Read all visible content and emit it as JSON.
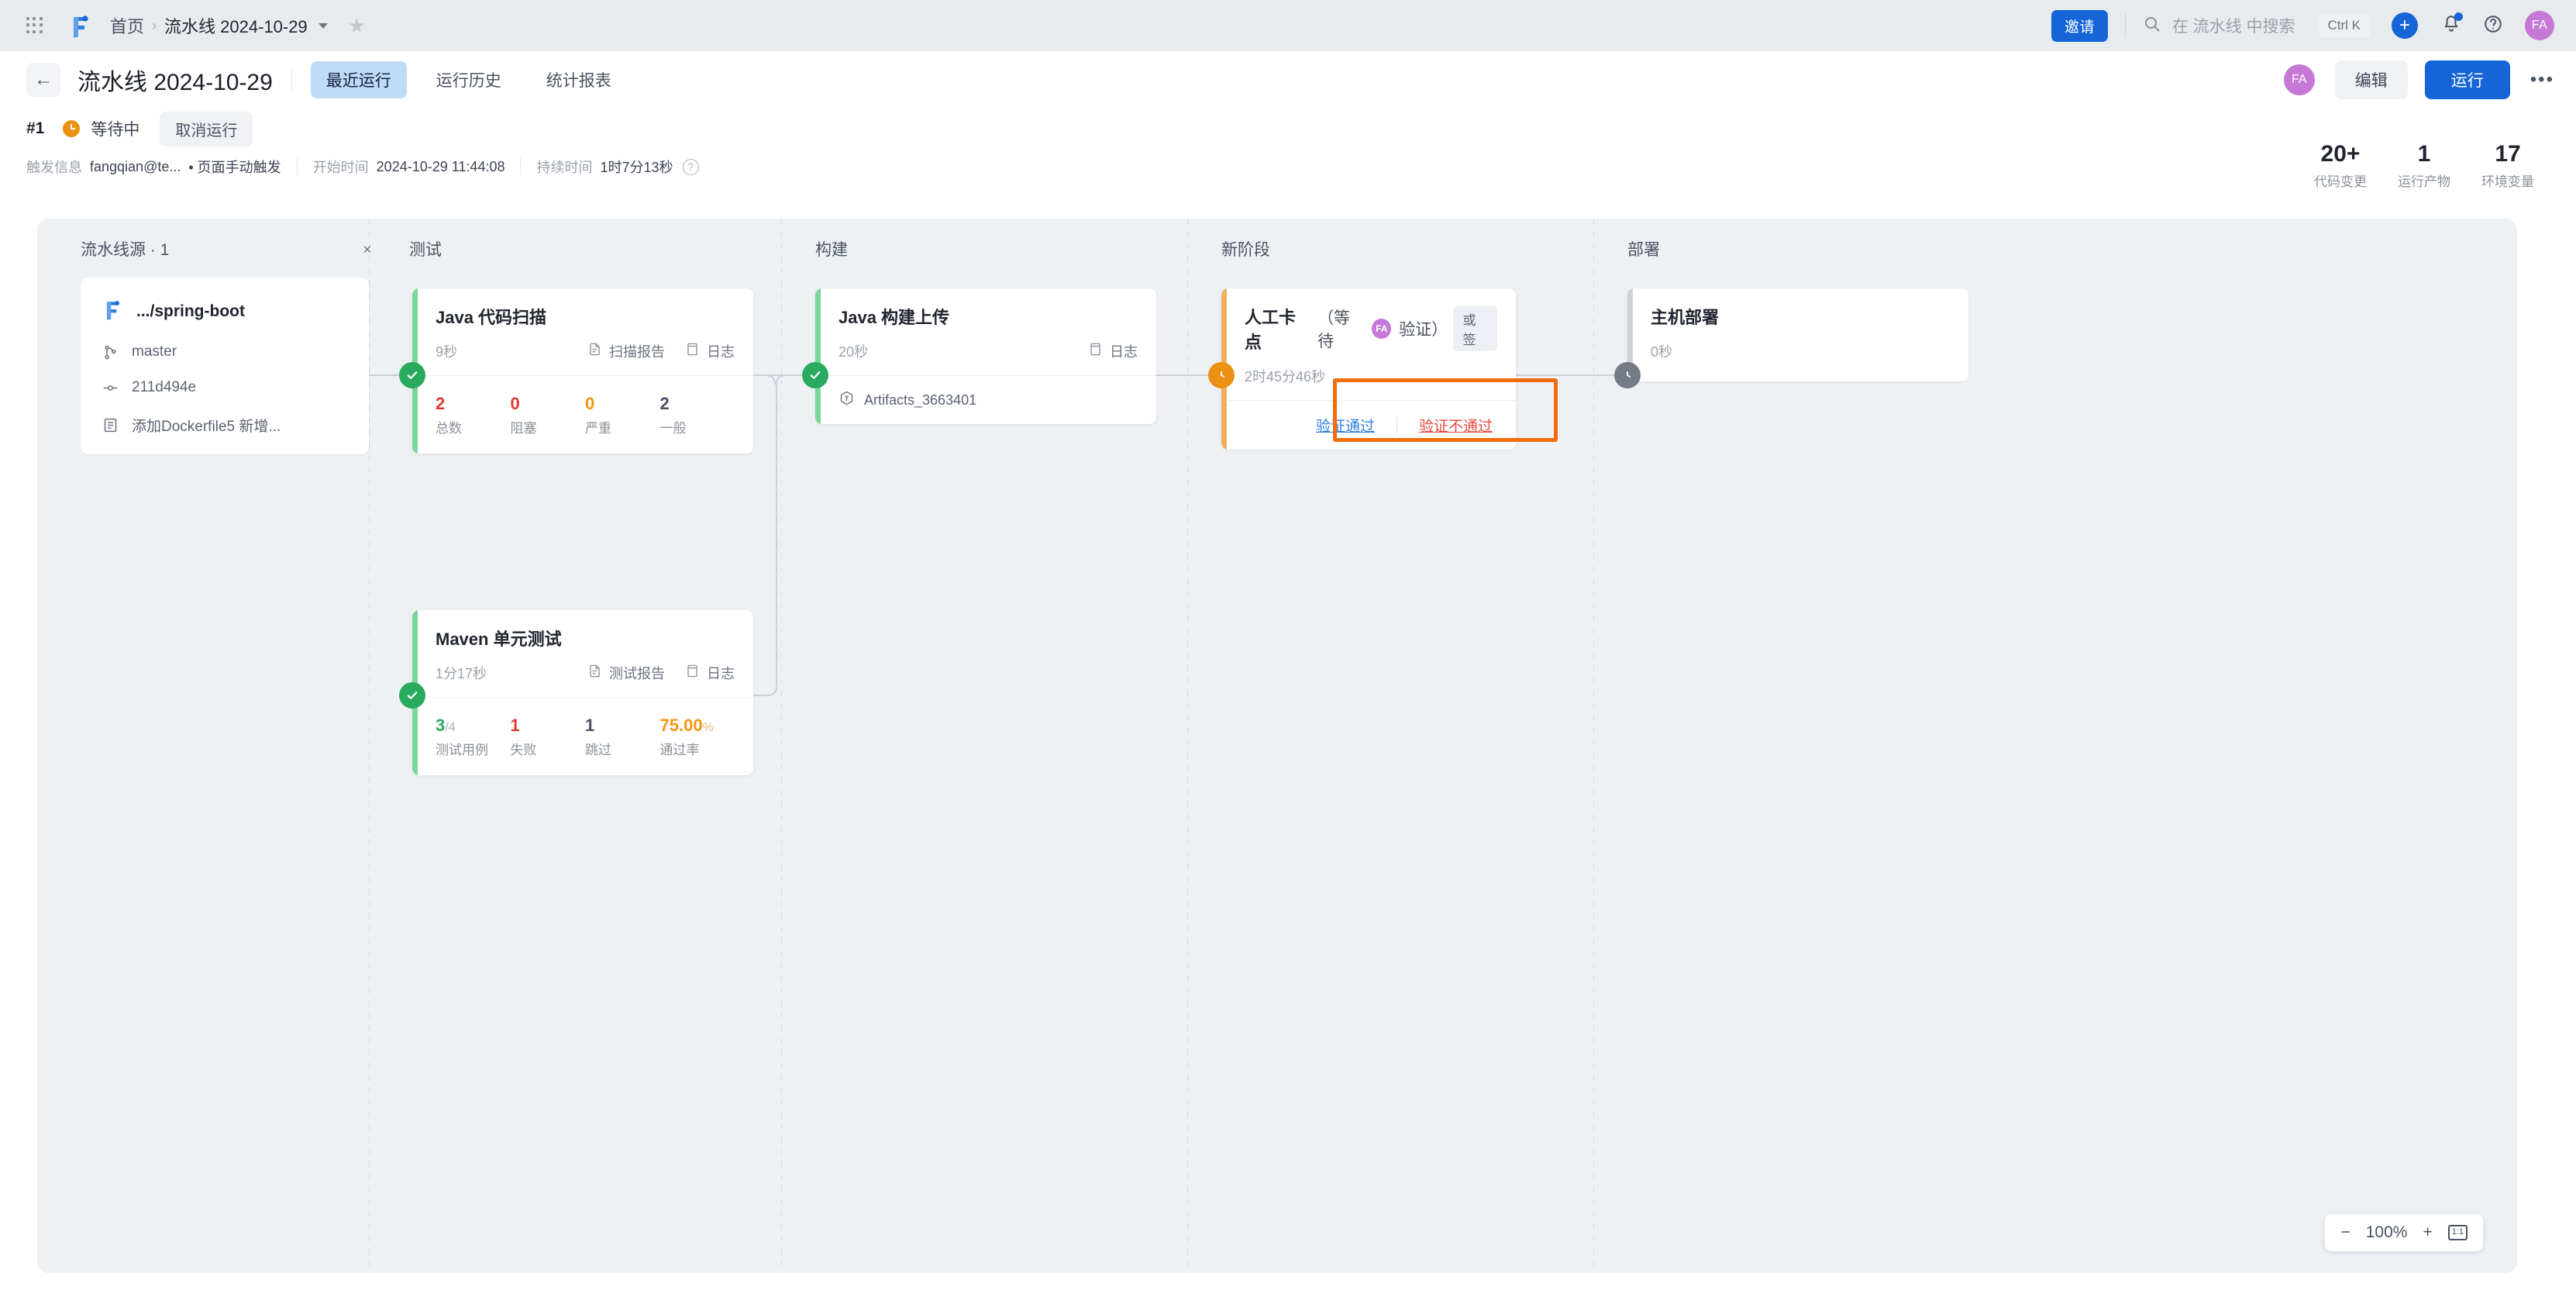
{
  "topbar": {
    "apps_icon": "grid-apps-icon",
    "logo": "flow-logo-icon",
    "breadcrumb_home": "首页",
    "breadcrumb_sep": "›",
    "breadcrumb_current": "流水线 2024-10-29",
    "star_icon": "★",
    "invite_label": "邀请",
    "search_placeholder": "在 流水线 中搜索",
    "search_shortcut": "Ctrl K",
    "plus_label": "+",
    "avatar_initials": "FA"
  },
  "subheader": {
    "back_icon": "←",
    "title": "流水线 2024-10-29",
    "tabs": [
      {
        "label": "最近运行",
        "active": true
      },
      {
        "label": "运行历史",
        "active": false
      },
      {
        "label": "统计报表",
        "active": false
      }
    ],
    "avatar_initials": "FA",
    "edit_label": "编辑",
    "run_label": "运行",
    "more_label": "•••"
  },
  "runbar": {
    "run_number": "#1",
    "status_text": "等待中",
    "cancel_label": "取消运行",
    "trigger_label": "触发信息",
    "trigger_user": "fangqian@te...",
    "trigger_mode": "• 页面手动触发",
    "start_label": "开始时间",
    "start_value": "2024-10-29 11:44:08",
    "duration_label": "持续时间",
    "duration_value": "1时7分13秒",
    "help_icon": "?"
  },
  "stats": [
    {
      "num": "20+",
      "label": "代码变更"
    },
    {
      "num": "1",
      "label": "运行产物"
    },
    {
      "num": "17",
      "label": "环境变量"
    }
  ],
  "source_panel": {
    "title": "流水线源 · 1",
    "collapse_icon": "collapse-icon",
    "repo_name": ".../spring-boot",
    "branch": "master",
    "commit": "211d494e",
    "message": "添加Dockerfile5 新增..."
  },
  "stages": [
    {
      "name": "测试",
      "jobs": [
        {
          "title": "Java 代码扫描",
          "status": "ok",
          "duration": "9秒",
          "links": [
            {
              "label": "扫描报告",
              "icon": "report-icon"
            },
            {
              "label": "日志",
              "icon": "log-icon"
            }
          ],
          "metrics": [
            {
              "value": "2",
              "label": "总数",
              "color": "#e03b2f"
            },
            {
              "value": "0",
              "label": "阻塞",
              "color": "#e03b2f"
            },
            {
              "value": "0",
              "label": "严重",
              "color": "#f59410"
            },
            {
              "value": "2",
              "label": "一般",
              "color": "#4a5160"
            }
          ]
        },
        {
          "title": "Maven 单元测试",
          "status": "ok",
          "duration": "1分17秒",
          "links": [
            {
              "label": "测试报告",
              "icon": "report-icon"
            },
            {
              "label": "日志",
              "icon": "log-icon"
            }
          ],
          "metrics": [
            {
              "value": "3",
              "suffix": "/4",
              "label": "测试用例",
              "color": "#2aaa5e"
            },
            {
              "value": "1",
              "label": "失败",
              "color": "#e03b2f"
            },
            {
              "value": "1",
              "label": "跳过",
              "color": "#4a5160"
            },
            {
              "value": "75.00",
              "suffix": "%",
              "label": "通过率",
              "color": "#f59410"
            }
          ]
        }
      ]
    },
    {
      "name": "构建",
      "jobs": [
        {
          "title": "Java 构建上传",
          "status": "ok",
          "duration": "20秒",
          "links": [
            {
              "label": "日志",
              "icon": "log-icon"
            }
          ],
          "artifact": "Artifacts_3663401"
        }
      ]
    },
    {
      "name": "新阶段",
      "jobs": [
        {
          "title": "人工卡点",
          "subtitle_pre": "（等待",
          "subtitle_post": "验证）",
          "avatar_initials": "FA",
          "chip": "或签",
          "status": "wait",
          "duration": "2时45分46秒",
          "approve_pass": "验证通过",
          "approve_fail": "验证不通过",
          "highlight_color": "#f26c0d"
        }
      ]
    },
    {
      "name": "部署",
      "jobs": [
        {
          "title": "主机部署",
          "status": "idle",
          "duration": "0秒"
        }
      ]
    }
  ],
  "zoom_control": {
    "minus": "−",
    "level": "100%",
    "plus": "+",
    "fit": "1:1"
  }
}
